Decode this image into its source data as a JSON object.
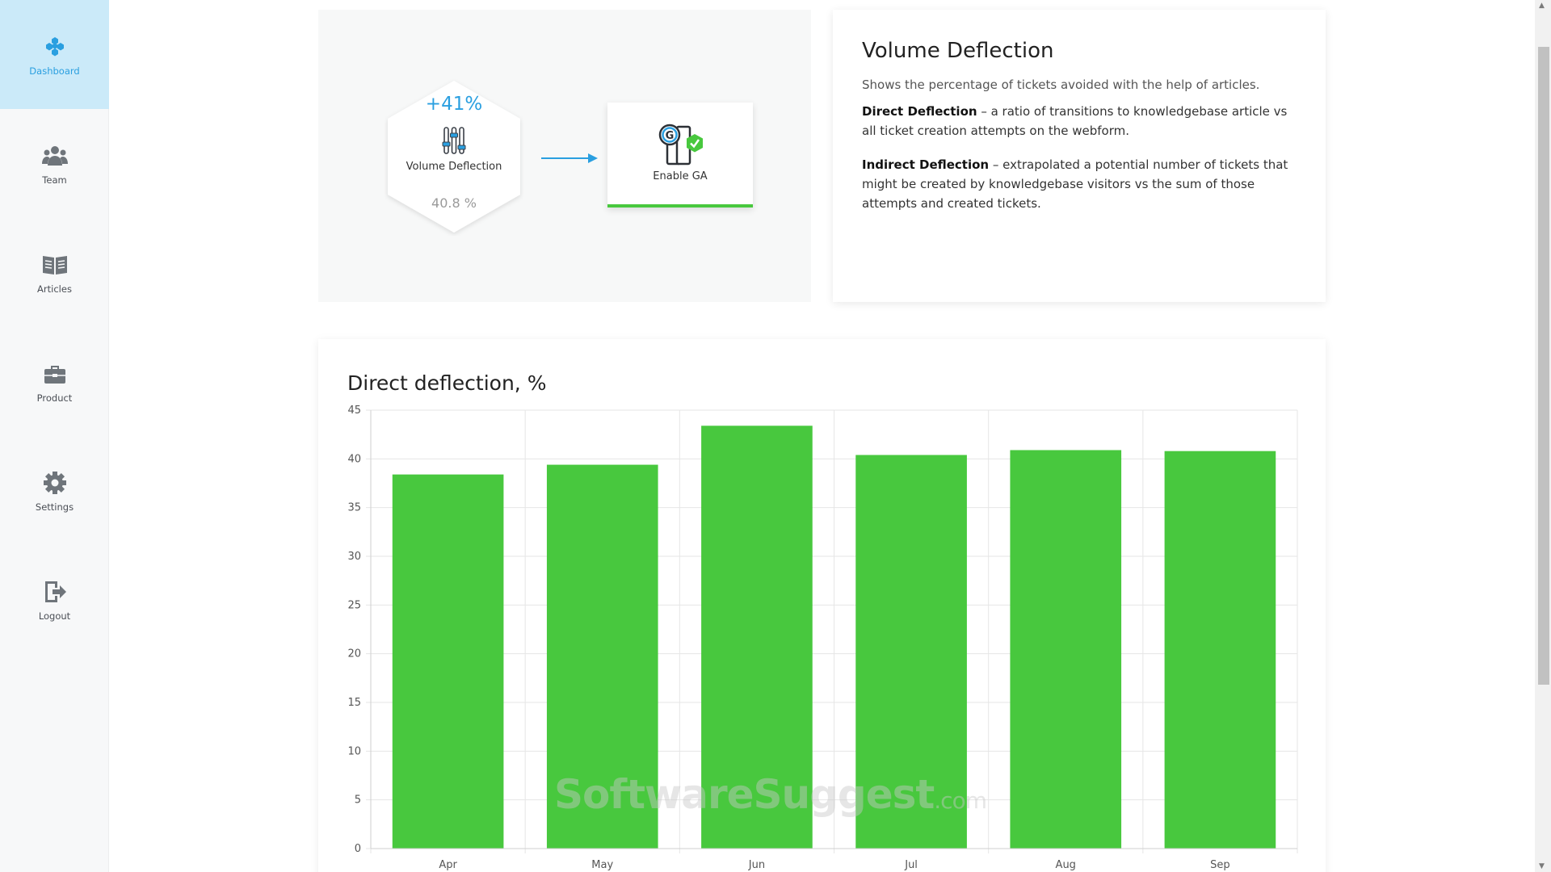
{
  "sidebar": {
    "items": [
      {
        "label": "Dashboard",
        "icon": "hexagon-cluster-icon",
        "active": true
      },
      {
        "label": "Team",
        "icon": "team-icon",
        "active": false
      },
      {
        "label": "Articles",
        "icon": "book-icon",
        "active": false
      },
      {
        "label": "Product",
        "icon": "briefcase-icon",
        "active": false
      },
      {
        "label": "Settings",
        "icon": "gear-icon",
        "active": false
      },
      {
        "label": "Logout",
        "icon": "logout-icon",
        "active": false
      }
    ]
  },
  "flow": {
    "metric_change": "+41%",
    "metric_label": "Volume Deflection",
    "metric_value": "40.8 %",
    "metric_icon": "sliders-icon",
    "action_label": "Enable GA",
    "action_icon": "google-analytics-check-icon"
  },
  "info": {
    "title": "Volume Deflection",
    "description": "Shows the percentage of tickets avoided with the help of articles.",
    "direct_term": "Direct Deflection",
    "direct_text": " – a ratio of transitions to knowledgebase article vs all ticket creation attempts on the webform.",
    "indirect_term": "Indirect Deflection",
    "indirect_text": " – extrapolated a potential number of tickets that might be created by knowledgebase visitors vs the sum of those attempts and created tickets."
  },
  "chart_title": "Direct deflection, %",
  "chart_data": {
    "type": "bar",
    "title": "Direct deflection, %",
    "categories": [
      "Apr",
      "May",
      "Jun",
      "Jul",
      "Aug",
      "Sep"
    ],
    "values": [
      38.4,
      39.4,
      43.4,
      40.4,
      40.9,
      40.8
    ],
    "ylim": [
      0,
      45
    ],
    "yticks": [
      0,
      5,
      10,
      15,
      20,
      25,
      30,
      35,
      40,
      45
    ],
    "grid": true,
    "bar_color": "#48c83e"
  },
  "watermark": {
    "main": "SoftwareSuggest",
    "suffix": ".com"
  },
  "colors": {
    "accent": "#2a9fe0",
    "success": "#48c83e",
    "active_nav": "#cbeaf9"
  }
}
